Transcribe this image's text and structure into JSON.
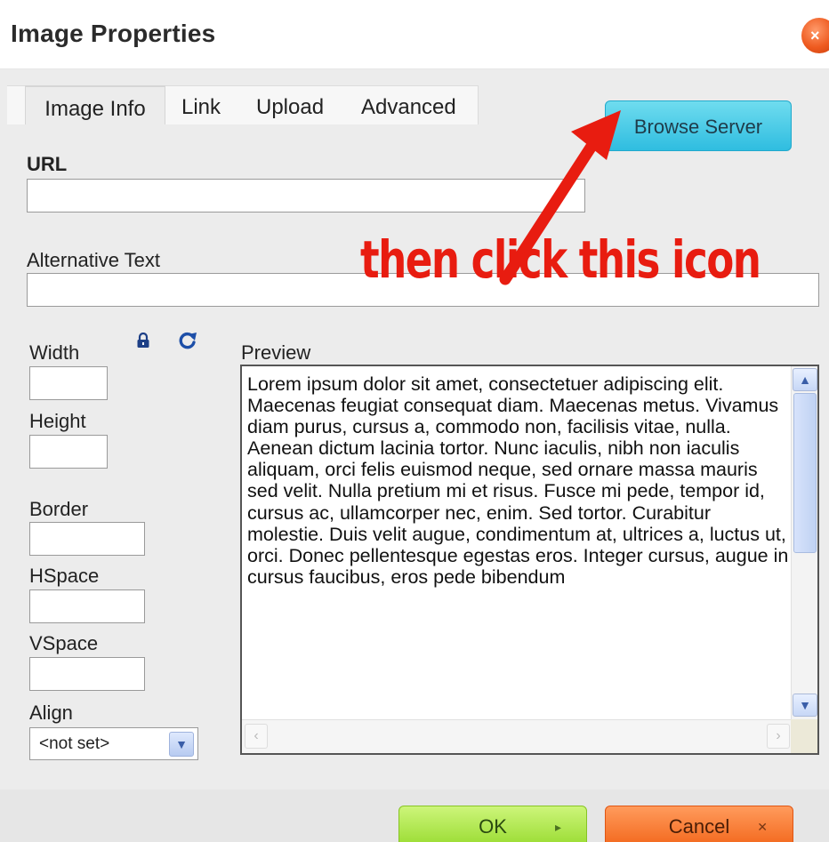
{
  "dialog": {
    "title": "Image Properties",
    "close_glyph": "×"
  },
  "tabs": [
    {
      "label": "Image Info",
      "active": true
    },
    {
      "label": "Link",
      "active": false
    },
    {
      "label": "Upload",
      "active": false
    },
    {
      "label": "Advanced",
      "active": false
    }
  ],
  "fields": {
    "url": {
      "label": "URL",
      "value": ""
    },
    "alt_text": {
      "label": "Alternative Text",
      "value": ""
    },
    "width": {
      "label": "Width",
      "value": ""
    },
    "height": {
      "label": "Height",
      "value": ""
    },
    "border": {
      "label": "Border",
      "value": ""
    },
    "hspace": {
      "label": "HSpace",
      "value": ""
    },
    "vspace": {
      "label": "VSpace",
      "value": ""
    },
    "align": {
      "label": "Align",
      "selected": "<not set>"
    }
  },
  "buttons": {
    "browse_server": "Browse Server",
    "ok": "OK",
    "cancel": "Cancel",
    "ok_glyph": "▸",
    "cancel_glyph": "✕"
  },
  "preview": {
    "label": "Preview",
    "text": "Lorem ipsum dolor sit amet, consectetuer adipiscing elit. Maecenas feugiat consequat diam. Maecenas metus. Vivamus diam purus, cursus a, commodo non, facilisis vitae, nulla. Aenean dictum lacinia tortor. Nunc iaculis, nibh non iaculis aliquam, orci felis euismod neque, sed ornare massa mauris sed velit. Nulla pretium mi et risus. Fusce mi pede, tempor id, cursus ac, ullamcorper nec, enim. Sed tortor. Curabitur molestie. Duis velit augue, condimentum at, ultrices a, luctus ut, orci. Donec pellentesque egestas eros. Integer cursus, augue in cursus faucibus, eros pede bibendum"
  },
  "annotation": {
    "text": "then click this icon",
    "color": "#e81c10"
  },
  "icons": {
    "lock": "lock-icon",
    "reset": "reset-size-icon"
  },
  "colors": {
    "browse_button": "#2fbde0",
    "ok_button": "#96da2d",
    "cancel_button": "#f26418",
    "close_button": "#ee5a1f"
  }
}
